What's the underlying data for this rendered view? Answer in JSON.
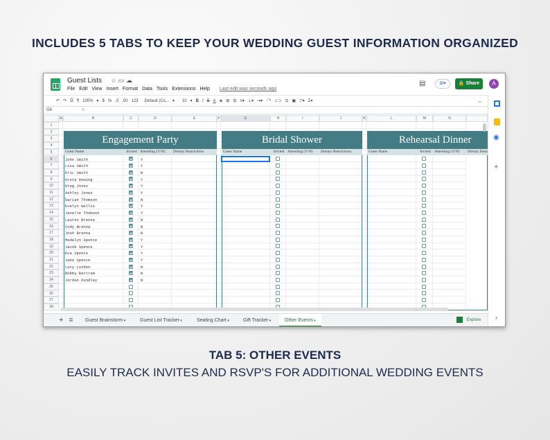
{
  "headline": "INCLUDES 5 TABS TO KEEP YOUR WEDDING GUEST INFORMATION ORGANIZED",
  "caption_title": "TAB 5: OTHER EVENTS",
  "caption_sub": "EASILY TRACK INVITES AND RSVP'S FOR ADDITIONAL WEDDING EVENTS",
  "colors": {
    "teal": "#437c84",
    "subheader": "#d5e2e4",
    "navy": "#1c2b4c",
    "share": "#188038"
  },
  "app": {
    "title": "Guest Lists",
    "menu": [
      "File",
      "Edit",
      "View",
      "Insert",
      "Format",
      "Data",
      "Tools",
      "Extensions",
      "Help"
    ],
    "last_edit": "Last edit was seconds ago",
    "share_label": "Share",
    "avatar": "A"
  },
  "toolbar": {
    "zoom": "100%",
    "currency": "$",
    "percent": "%",
    "dec_dec": ".0",
    "inc_dec": ".00",
    "format": "123",
    "font": "Default (Co...",
    "size": "10",
    "bold": "B",
    "italic": "I",
    "strike": "S",
    "color": "A"
  },
  "formula": {
    "cell_ref": "G6",
    "fx": "fx"
  },
  "columns": [
    "A",
    "B",
    "C",
    "D",
    "E",
    "F",
    "G",
    "H",
    "I",
    "J",
    "K",
    "L",
    "M",
    "N",
    ""
  ],
  "rows": [
    1,
    2,
    3,
    4,
    5,
    6,
    7,
    8,
    9,
    10,
    11,
    12,
    13,
    14,
    15,
    16,
    17,
    18,
    19,
    20,
    21,
    22,
    23,
    24,
    25,
    26,
    27,
    28
  ],
  "events": [
    {
      "title": "Engagement Party",
      "headers": [
        "Guest Name",
        "Invited",
        "Attending (Y/N)",
        "Dietary Restrictions"
      ],
      "guests": [
        [
          "John Smith",
          true,
          "Y"
        ],
        [
          "Lisa Smith",
          true,
          "Y"
        ],
        [
          "Eric Smith",
          true,
          "N"
        ],
        [
          "Greta Dowing",
          true,
          "Y"
        ],
        [
          "Greg Jones",
          true,
          "Y"
        ],
        [
          "Ashley Jones",
          true,
          "Y"
        ],
        [
          "Darian Thomson",
          true,
          "N"
        ],
        [
          "Evelyn Wallis",
          true,
          "Y"
        ],
        [
          "Janelle Thomson",
          true,
          "Y"
        ],
        [
          "Lauren Brenna",
          true,
          "N"
        ],
        [
          "Cody Brenna",
          true,
          "N"
        ],
        [
          "Josh Brenna",
          true,
          "N"
        ],
        [
          "Madalyn Spence",
          true,
          "Y"
        ],
        [
          "Jacob Spence",
          true,
          "Y"
        ],
        [
          "Eva Spence",
          true,
          "Y"
        ],
        [
          "Jake Spence",
          true,
          "Y"
        ],
        [
          "Lucy Lindon",
          true,
          "N"
        ],
        [
          "Robby Bartram",
          true,
          "N"
        ],
        [
          "Jordan Dundley",
          true,
          "N"
        ]
      ]
    },
    {
      "title": "Bridal Shower",
      "headers": [
        "Guest Name",
        "Invited",
        "Attending (Y/N)",
        "Dietary Restrictions"
      ],
      "guests": []
    },
    {
      "title": "Rehearsal Dinner",
      "headers": [
        "Guest Name",
        "Invited",
        "Attending (Y/N)",
        "Dietary Restrictions"
      ],
      "guests": []
    }
  ],
  "sheet_tabs": [
    {
      "label": "Guest Brainstorm"
    },
    {
      "label": "Guest List Tracker"
    },
    {
      "label": "Seating Chart"
    },
    {
      "label": "Gift Tracker"
    },
    {
      "label": "Other Events",
      "active": true
    }
  ],
  "explore_label": "Explore"
}
